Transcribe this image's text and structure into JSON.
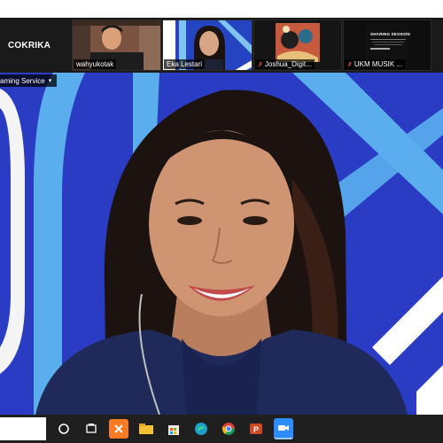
{
  "meeting": {
    "app_label": "COKRIKA",
    "view_label": "aming Service"
  },
  "gallery": [
    {
      "name": "wahyukotak",
      "muted": false
    },
    {
      "name": "Eka Lestari",
      "muted": false
    },
    {
      "name": "Joshua_Digit...",
      "muted": true
    },
    {
      "name": "UKM MUSIK ...",
      "muted": true
    }
  ],
  "tile4": {
    "title": "SHARING SESSION"
  },
  "colors": {
    "bg_blue": "#2c3fc8",
    "stripe_light": "#5fb2f0",
    "taskbar": "#1f1f1f"
  },
  "taskbar_icons": [
    "start-circle-icon",
    "task-view-icon",
    "xampp-icon",
    "file-explorer-icon",
    "store-icon",
    "edge-icon",
    "chrome-icon",
    "powerpoint-icon",
    "zoom-icon"
  ]
}
